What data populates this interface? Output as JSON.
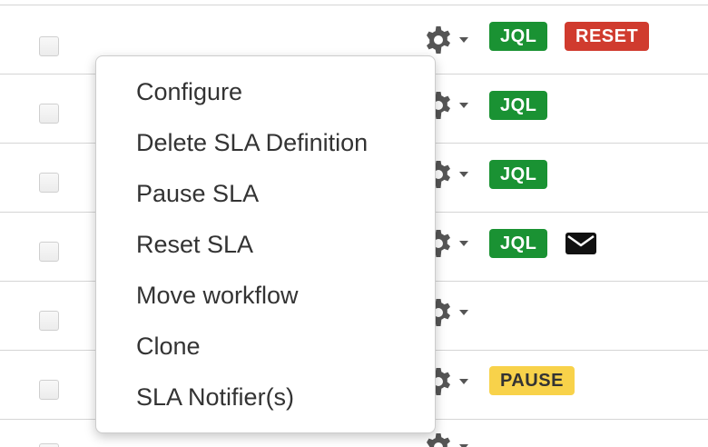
{
  "rows": [
    {
      "badges": [
        "JQL",
        "RESET"
      ]
    },
    {
      "badges": [
        "JQL"
      ]
    },
    {
      "badges": [
        "JQL"
      ]
    },
    {
      "badges": [
        "JQL"
      ],
      "icons": [
        "envelope-icon"
      ]
    },
    {
      "badges": []
    },
    {
      "badges": [
        "PAUSE"
      ]
    },
    {
      "badges": []
    }
  ],
  "badges": {
    "jql": "JQL",
    "reset": "RESET",
    "pause": "PAUSE"
  },
  "colors": {
    "jql": "#1a9233",
    "reset": "#d03b2e",
    "pause": "#f8d24a",
    "menu_text": "#333333"
  },
  "icons": {
    "gear": "gear-icon",
    "caret": "caret-down-icon",
    "envelope": "envelope-icon"
  },
  "menu": {
    "items": [
      "Configure",
      "Delete SLA Definition",
      "Pause SLA",
      "Reset SLA",
      "Move workflow",
      "Clone",
      "SLA Notifier(s)"
    ]
  }
}
